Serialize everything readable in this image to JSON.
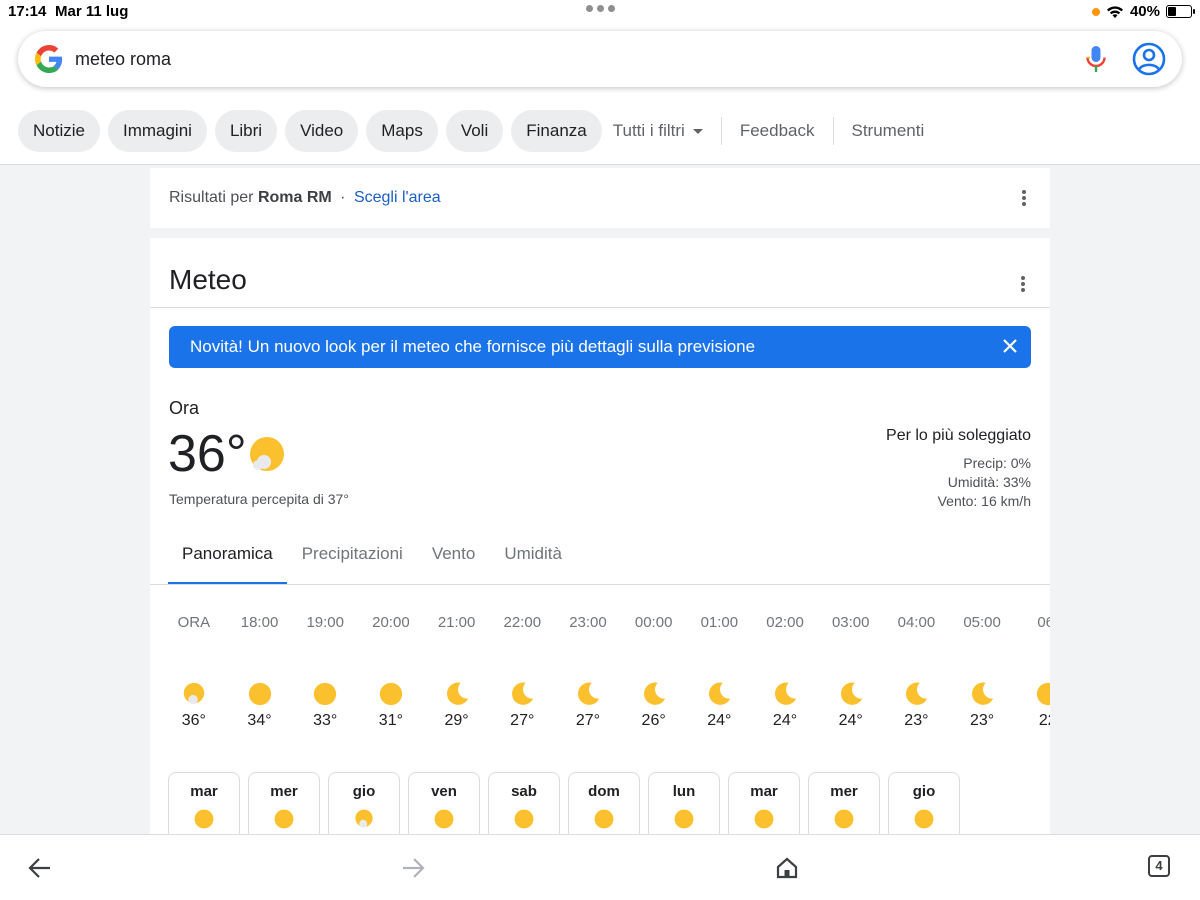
{
  "status": {
    "time": "17:14",
    "date": "Mar 11 lug",
    "battery": "40%",
    "battery_level": 0.4
  },
  "search": {
    "query": "meteo roma",
    "icons": [
      "google-logo",
      "mic-icon",
      "account-icon"
    ]
  },
  "chips": [
    "Notizie",
    "Immagini",
    "Libri",
    "Video",
    "Maps",
    "Voli",
    "Finanza"
  ],
  "filters": {
    "all": "Tutti i filtri",
    "feedback": "Feedback",
    "tools": "Strumenti"
  },
  "location": {
    "prefix": "Risultati per",
    "place": "Roma RM",
    "sep": "·",
    "choose": "Scegli l'area"
  },
  "weather": {
    "title": "Meteo",
    "banner": "Novità! Un nuovo look per il meteo che fornisce più dettagli sulla previsione",
    "now_label": "Ora",
    "temp": "36°",
    "feels": "Temperatura percepita di 37°",
    "condition": "Per lo più soleggiato",
    "precip": "Precip: 0%",
    "humidity": "Umidità: 33%",
    "wind": "Vento: 16 km/h",
    "tabs": [
      "Panoramica",
      "Precipitazioni",
      "Vento",
      "Umidità"
    ],
    "hourly": [
      {
        "h": "ORA",
        "t": "36°",
        "icon": "partly-sunny"
      },
      {
        "h": "18:00",
        "t": "34°",
        "icon": "sun"
      },
      {
        "h": "19:00",
        "t": "33°",
        "icon": "sun"
      },
      {
        "h": "20:00",
        "t": "31°",
        "icon": "sun"
      },
      {
        "h": "21:00",
        "t": "29°",
        "icon": "moon"
      },
      {
        "h": "22:00",
        "t": "27°",
        "icon": "moon"
      },
      {
        "h": "23:00",
        "t": "27°",
        "icon": "moon"
      },
      {
        "h": "00:00",
        "t": "26°",
        "icon": "moon"
      },
      {
        "h": "01:00",
        "t": "24°",
        "icon": "moon"
      },
      {
        "h": "02:00",
        "t": "24°",
        "icon": "moon"
      },
      {
        "h": "03:00",
        "t": "24°",
        "icon": "moon"
      },
      {
        "h": "04:00",
        "t": "23°",
        "icon": "moon"
      },
      {
        "h": "05:00",
        "t": "23°",
        "icon": "moon"
      },
      {
        "h": "06:",
        "t": "22",
        "icon": "sun"
      }
    ],
    "daily": [
      {
        "d": "mar",
        "icon": "sun"
      },
      {
        "d": "mer",
        "icon": "sun"
      },
      {
        "d": "gio",
        "icon": "partly-sunny"
      },
      {
        "d": "ven",
        "icon": "sun"
      },
      {
        "d": "sab",
        "icon": "sun"
      },
      {
        "d": "dom",
        "icon": "sun"
      },
      {
        "d": "lun",
        "icon": "sun"
      },
      {
        "d": "mar",
        "icon": "sun"
      },
      {
        "d": "mer",
        "icon": "sun"
      },
      {
        "d": "gio",
        "icon": "sun"
      }
    ]
  },
  "toolbar": {
    "tabs_count": "4",
    "icons": [
      "back-icon",
      "forward-icon",
      "home-icon",
      "tabs-icon"
    ]
  },
  "colors": {
    "accent": "#1a73e8",
    "sun": "#fbc02d",
    "link": "#1a5fc8"
  }
}
